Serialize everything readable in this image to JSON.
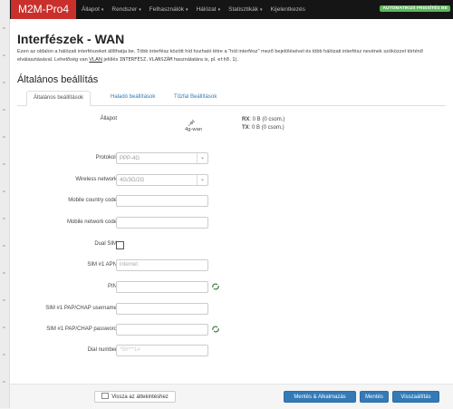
{
  "navbar": {
    "brand": "M2M-Pro4",
    "menu": [
      {
        "label": "Állapot",
        "caret": "▾"
      },
      {
        "label": "Rendszer",
        "caret": "▾"
      },
      {
        "label": "Felhasználók",
        "caret": "▾"
      },
      {
        "label": "Hálózat",
        "caret": "▾"
      },
      {
        "label": "Statisztikák",
        "caret": "▾"
      },
      {
        "label": "Kijelentkezés",
        "caret": ""
      }
    ],
    "auto_refresh": "AUTOMATIKUS FRISSÍTÉS BE"
  },
  "page": {
    "title": "Interfészek - WAN",
    "desc_part1": "Ezen az oldalon a hálózati interfészeket állíthatja be. Több interfész között híd hozható létre a \"híd interfész\" mező bejelölésével és több hálózati interfész nevének szóközzel történő elválasztásával. Lehetőség van ",
    "desc_vlan": "VLAN",
    "desc_part2": " jelölés ",
    "desc_code1": "INTERFÉSZ.VLANSZÁM",
    "desc_part3": " használatára is, pl. ",
    "desc_code2": "eth0.1",
    "desc_part4": ").",
    "section_title": "Általános beállítás"
  },
  "tabs": [
    "Általános beállítások",
    "Haladó beállítások",
    "Tűzfal Beállítások"
  ],
  "status": {
    "label": "Állapot",
    "iface_name": "4g-wan",
    "rx_label": "RX",
    "rx_value": ": 0 B (0 csom.)",
    "tx_label": "TX",
    "tx_value": ": 0 B (0 csom.)"
  },
  "form": {
    "protocol": {
      "label": "Protokoll",
      "value": "PPP-4G"
    },
    "wireless_network": {
      "label": "Wireless network",
      "value": "4G/3G/2G"
    },
    "mcc": {
      "label": "Mobile country code",
      "value": ""
    },
    "mnc": {
      "label": "Mobile network code",
      "value": ""
    },
    "dual_sim": {
      "label": "Dual SIM"
    },
    "apn": {
      "label": "SIM #1 APN",
      "value": "internet"
    },
    "pin": {
      "label": "PIN",
      "value": ""
    },
    "chap_user": {
      "label": "SIM #1 PAP/CHAP username",
      "value": ""
    },
    "chap_pass": {
      "label": "SIM #1 PAP/CHAP password",
      "value": ""
    },
    "dial": {
      "label": "Dial number",
      "value": "*99***1#"
    }
  },
  "footer": {
    "back": "Vissza az áttekintéshez",
    "save_apply": "Mentés & Alkalmazás",
    "save": "Mentés",
    "reset": "Visszaállítás"
  },
  "colors": {
    "brand": "#c9302c",
    "primary": "#337ab7",
    "auto_refresh": "#5cb85c"
  },
  "icons": {
    "interface": "network-icon",
    "reveal": "reveal-password-icon",
    "back": "back-icon"
  }
}
